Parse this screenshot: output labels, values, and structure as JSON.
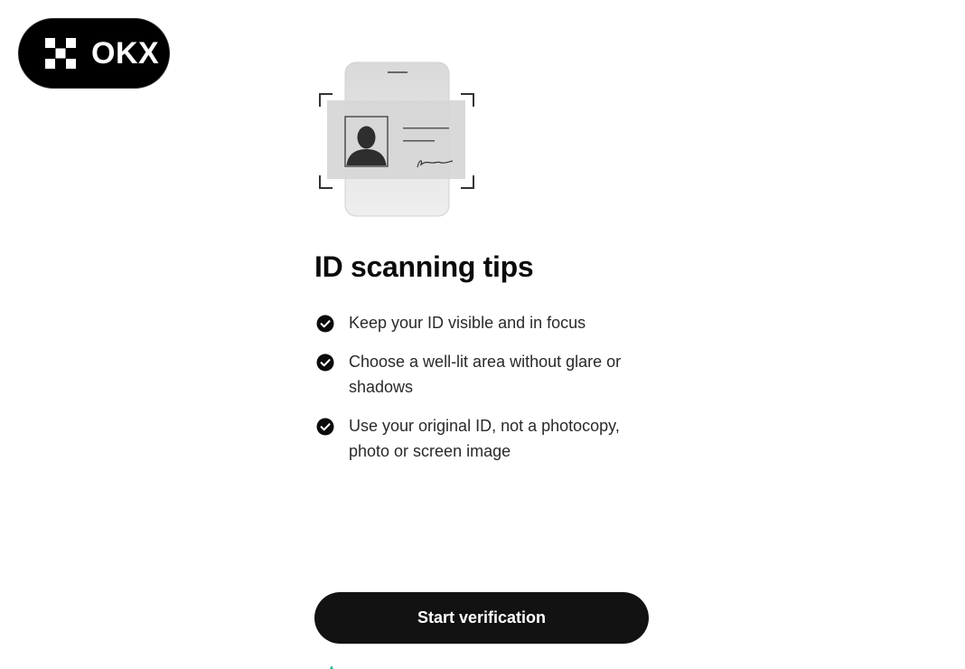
{
  "brand": {
    "name": "OKX",
    "logo_icon": "okx-checker-mark",
    "pill_color": "#000000",
    "text_color": "#ffffff"
  },
  "illustration": {
    "icon": "id-card-scan-illustration"
  },
  "heading": "ID scanning tips",
  "tips": [
    {
      "icon": "check-circle-icon",
      "text": "Keep your ID visible and in focus"
    },
    {
      "icon": "check-circle-icon",
      "text": "Choose a well-lit area without glare or shadows"
    },
    {
      "icon": "check-circle-icon",
      "text": "Use your original ID, not a photocopy, photo or screen image"
    }
  ],
  "actions": {
    "primary_label": "Start verification",
    "primary_color": "#121212"
  },
  "colors": {
    "background": "#ffffff",
    "text": "#121212",
    "accent_peek": "#1fbf8f"
  }
}
